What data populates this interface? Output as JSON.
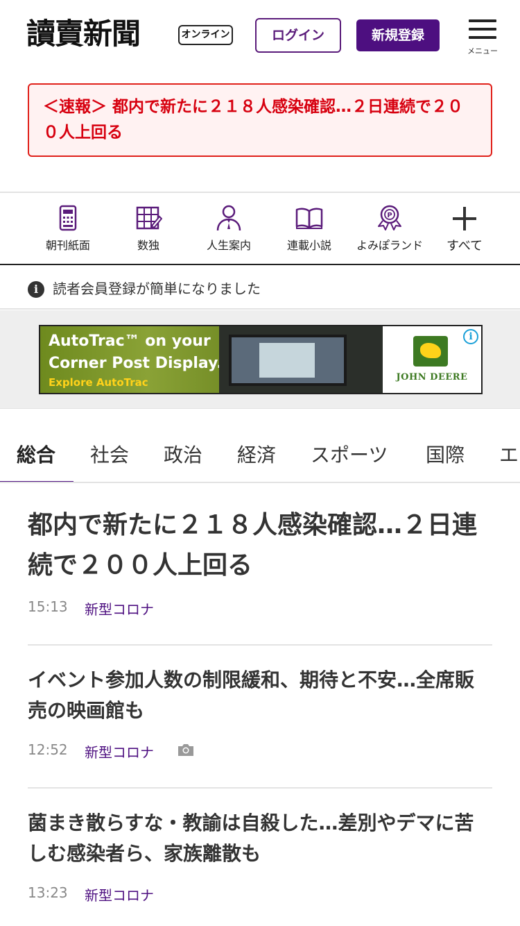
{
  "header": {
    "logo_text": "讀賣新聞",
    "online_badge": "オンライン",
    "login_label": "ログイン",
    "register_label": "新規登録",
    "menu_label": "メニュー"
  },
  "breaking": {
    "text": "＜速報＞ 都内で新たに２１８人感染確認…２日連続で２００人上回る"
  },
  "shortcuts": [
    {
      "label": "朝刊紙面",
      "icon": "newspaper-icon"
    },
    {
      "label": "数独",
      "icon": "sudoku-icon"
    },
    {
      "label": "人生案内",
      "icon": "person-icon"
    },
    {
      "label": "連載小説",
      "icon": "book-icon"
    },
    {
      "label": "よみぽランド",
      "icon": "points-medal-icon"
    },
    {
      "label": "すべて",
      "icon": "plus-icon"
    }
  ],
  "info": {
    "icon": "info-icon",
    "text": "読者会員登録が簡単になりました"
  },
  "ad": {
    "line1": "AutoTrac™ on your",
    "line2": "Corner Post Display.",
    "line3": "Explore AutoTrac",
    "brand": "JOHN DEERE",
    "info_icon": "i"
  },
  "tabs": [
    "総合",
    "社会",
    "政治",
    "経済",
    "スポーツ",
    "国際",
    "エ"
  ],
  "articles": [
    {
      "title": "都内で新たに２１８人感染確認…２日連続で２００人上回る",
      "time": "15:13",
      "category": "新型コロナ",
      "has_photo": false
    },
    {
      "title": "イベント参加人数の制限緩和、期待と不安…全席販売の映画館も",
      "time": "12:52",
      "category": "新型コロナ",
      "has_photo": true
    },
    {
      "title": "菌まき散らすな・教諭は自殺した…差別やデマに苦しむ感染者ら、家族離散も",
      "time": "13:23",
      "category": "新型コロナ",
      "has_photo": false
    }
  ],
  "colors": {
    "brand_purple": "#4d0f80",
    "breaking_red": "#d7000f"
  }
}
